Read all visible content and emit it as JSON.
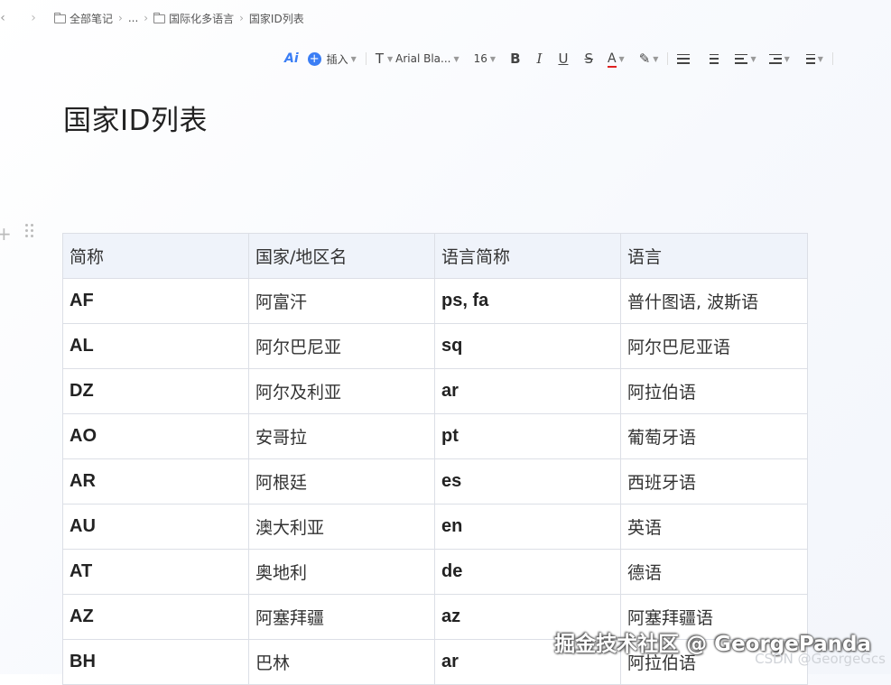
{
  "breadcrumb": {
    "items": [
      "全部笔记",
      "...",
      "国际化多语言",
      "国家ID列表"
    ]
  },
  "toolbar": {
    "ai_label": "Ai",
    "insert_label": "插入",
    "font_name": "Arial Bla...",
    "font_size": "16",
    "bold": "B",
    "italic": "I",
    "underline": "U",
    "strike": "S",
    "font_color": "A",
    "font_color_value": "#e02020",
    "text_style_glyph": "T"
  },
  "document": {
    "title": "国家ID列表"
  },
  "table": {
    "headers": [
      "简称",
      "国家/地区名",
      "语言简称",
      "语言"
    ],
    "rows": [
      [
        "AF",
        "阿富汗",
        "ps, fa",
        "普什图语, 波斯语"
      ],
      [
        "AL",
        "阿尔巴尼亚",
        "sq",
        "阿尔巴尼亚语"
      ],
      [
        "DZ",
        "阿尔及利亚",
        "ar",
        "阿拉伯语"
      ],
      [
        "AO",
        "安哥拉",
        "pt",
        "葡萄牙语"
      ],
      [
        "AR",
        "阿根廷",
        "es",
        "西班牙语"
      ],
      [
        "AU",
        "澳大利亚",
        "en",
        "英语"
      ],
      [
        "AT",
        "奥地利",
        "de",
        "德语"
      ],
      [
        "AZ",
        "阿塞拜疆",
        "az",
        "阿塞拜疆语"
      ],
      [
        "BH",
        "巴林",
        "ar",
        "阿拉伯语"
      ]
    ]
  },
  "watermark": {
    "main": "掘金技术社区 @ GeorgePanda",
    "sub": "CSDN @GeorgeGcs"
  },
  "colors": {
    "accent": "#3b7ef5",
    "header_bg": "#eff3fa",
    "border": "#dcdfe6"
  }
}
